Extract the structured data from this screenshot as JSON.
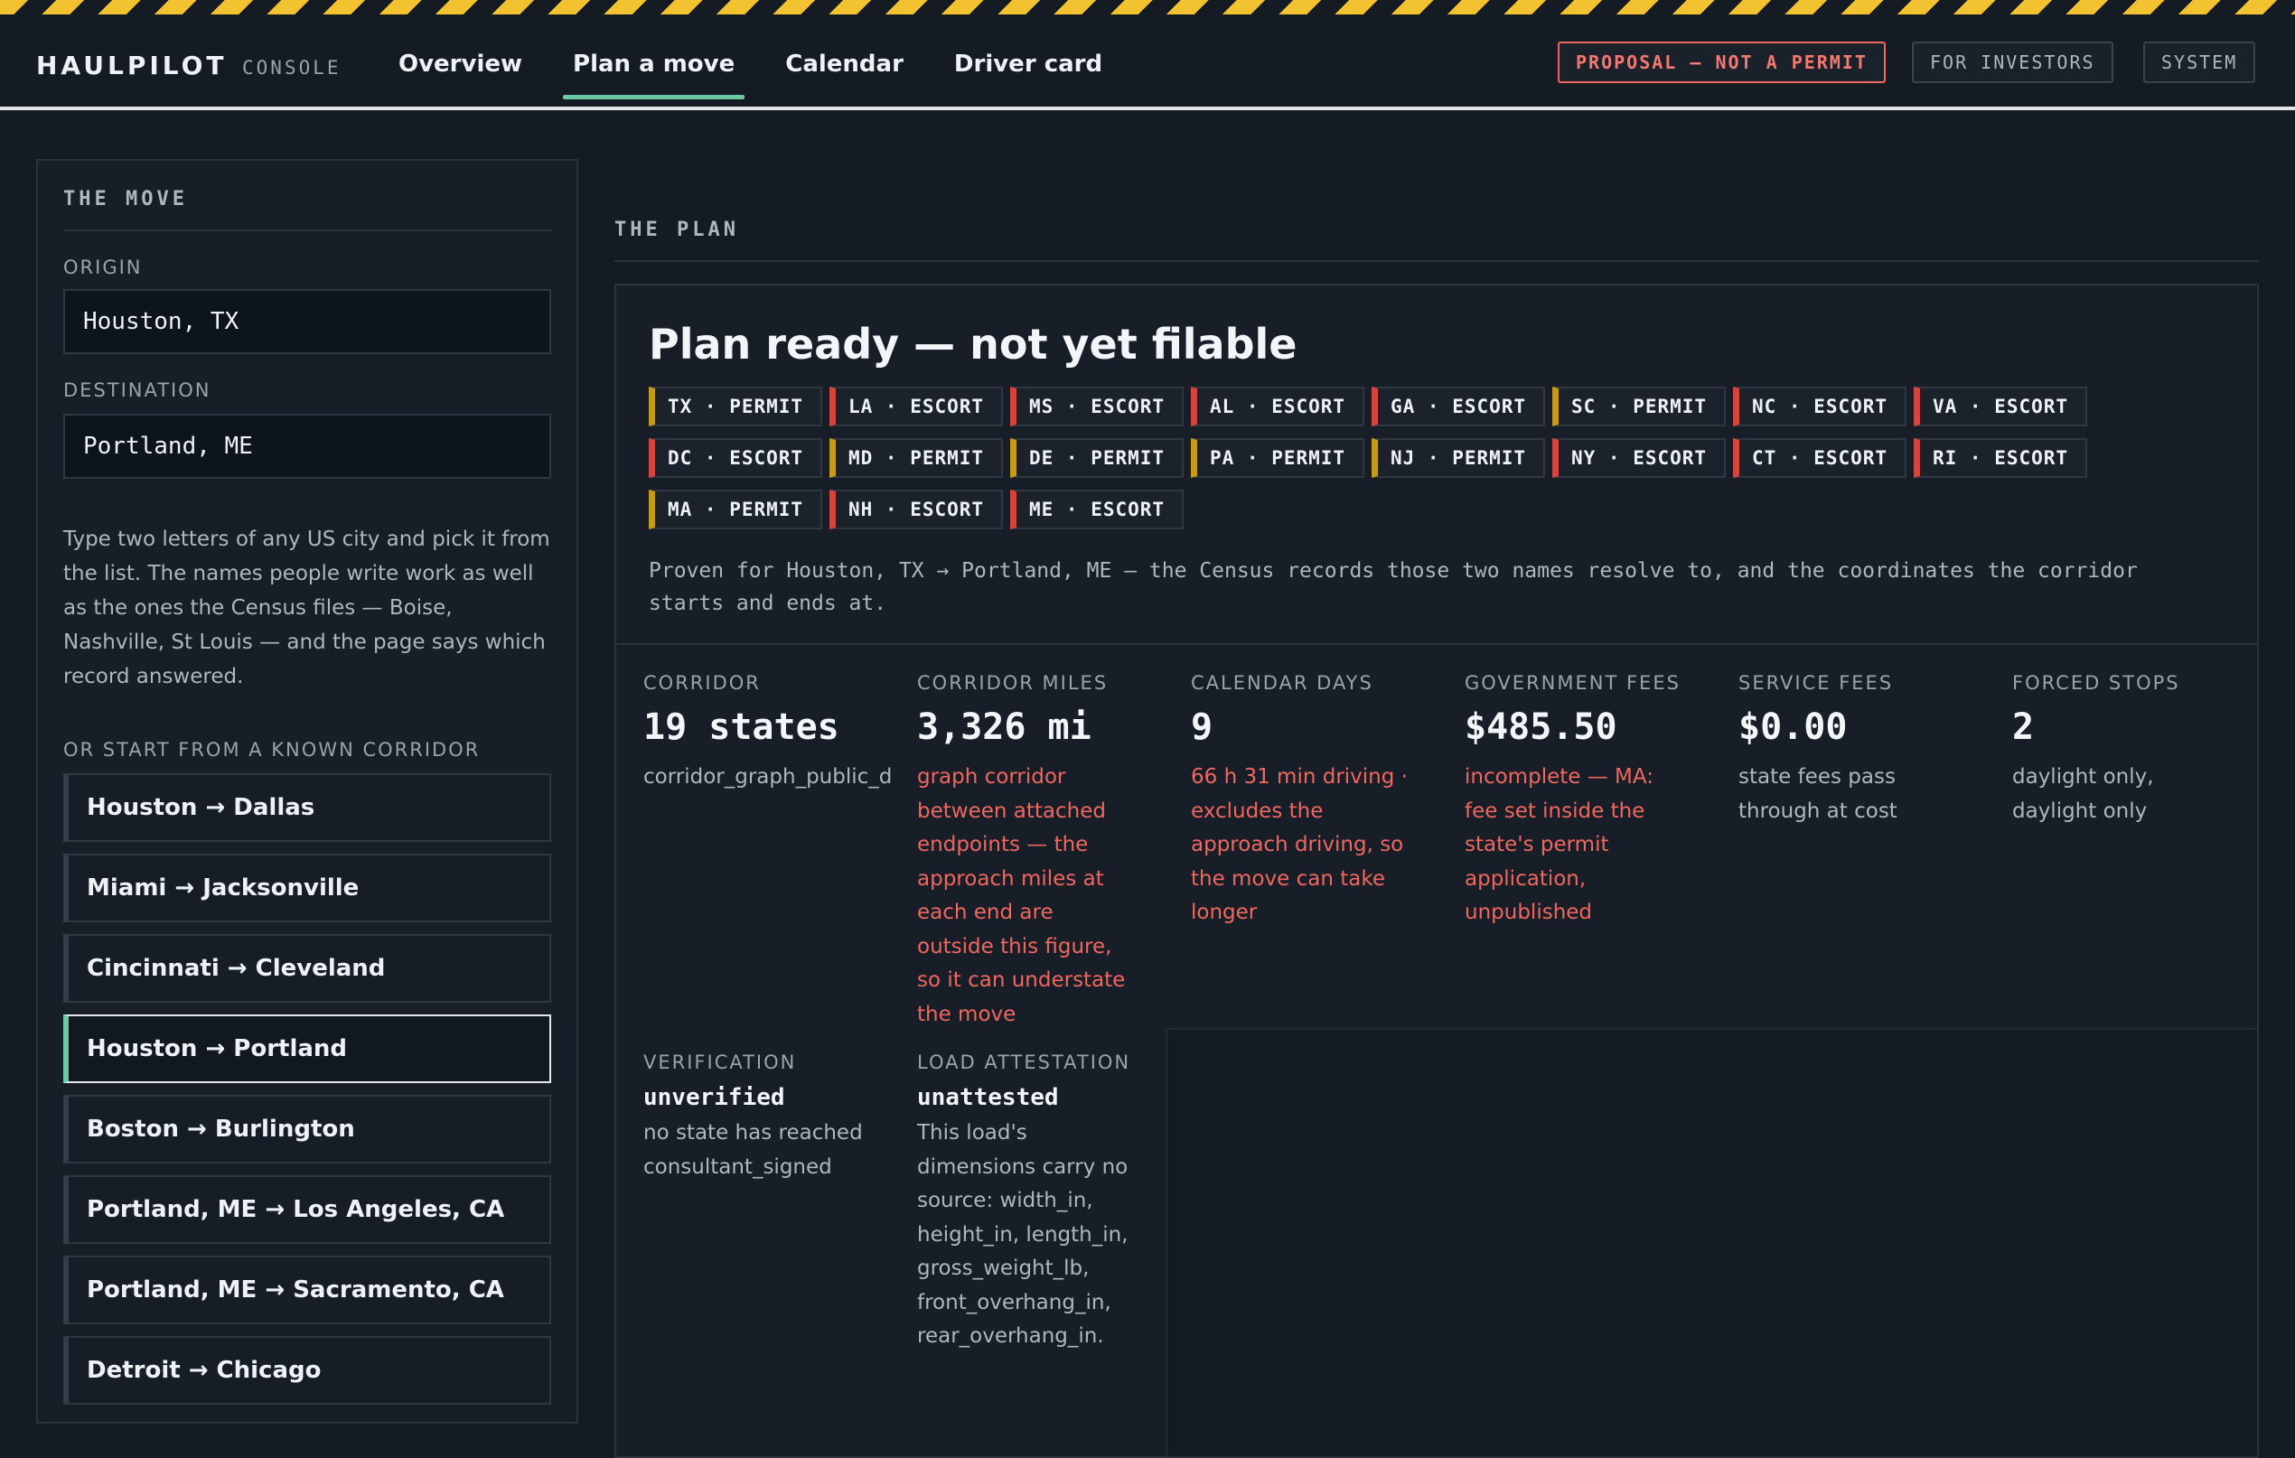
{
  "app": {
    "brand": "HAULPILOT",
    "brand_sub": "CONSOLE"
  },
  "nav": {
    "tabs": [
      {
        "label": "Overview"
      },
      {
        "label": "Plan a move",
        "active": true
      },
      {
        "label": "Calendar"
      },
      {
        "label": "Driver card"
      }
    ]
  },
  "top_actions": {
    "proposal": "PROPOSAL — NOT A PERMIT",
    "investors": "FOR INVESTORS",
    "system": "SYSTEM"
  },
  "move": {
    "title": "THE MOVE",
    "origin_label": "ORIGIN",
    "origin_value": "Houston, TX",
    "destination_label": "DESTINATION",
    "destination_value": "Portland, ME",
    "help": "Type two letters of any US city and pick it from the list. The names people write work as well as the ones the Census files — Boise, Nashville, St Louis — and the page says which record answered.",
    "corridor_label": "OR START FROM A KNOWN CORRIDOR",
    "corridors": [
      "Houston → Dallas",
      "Miami → Jacksonville",
      "Cincinnati → Cleveland",
      "Houston → Portland",
      "Boston → Burlington",
      "Portland, ME → Los Angeles, CA",
      "Portland, ME → Sacramento, CA",
      "Detroit → Chicago"
    ],
    "active_corridor": "Houston → Portland"
  },
  "plan": {
    "title": "THE PLAN",
    "status": "Plan ready — not yet filable",
    "states": [
      {
        "label": "TX · PERMIT",
        "kind": "permit"
      },
      {
        "label": "LA · ESCORT",
        "kind": "escort"
      },
      {
        "label": "MS · ESCORT",
        "kind": "escort"
      },
      {
        "label": "AL · ESCORT",
        "kind": "escort"
      },
      {
        "label": "GA · ESCORT",
        "kind": "escort"
      },
      {
        "label": "SC · PERMIT",
        "kind": "permit"
      },
      {
        "label": "NC · ESCORT",
        "kind": "escort"
      },
      {
        "label": "VA · ESCORT",
        "kind": "escort"
      },
      {
        "label": "DC · ESCORT",
        "kind": "escort"
      },
      {
        "label": "MD · PERMIT",
        "kind": "permit"
      },
      {
        "label": "DE · PERMIT",
        "kind": "permit"
      },
      {
        "label": "PA · PERMIT",
        "kind": "permit"
      },
      {
        "label": "NJ · PERMIT",
        "kind": "permit"
      },
      {
        "label": "NY · ESCORT",
        "kind": "escort"
      },
      {
        "label": "CT · ESCORT",
        "kind": "escort"
      },
      {
        "label": "RI · ESCORT",
        "kind": "escort"
      },
      {
        "label": "MA · PERMIT",
        "kind": "permit"
      },
      {
        "label": "NH · ESCORT",
        "kind": "escort"
      },
      {
        "label": "ME · ESCORT",
        "kind": "escort"
      }
    ],
    "proven": "Proven for Houston, TX → Portland, ME — the Census records those two names resolve to, and the coordinates the corridor starts and ends at.",
    "stats": {
      "corridor": {
        "label": "CORRIDOR",
        "value": "19 states",
        "note": "corridor_graph_public_data"
      },
      "miles": {
        "label": "CORRIDOR MILES",
        "value": "3,326 mi",
        "note": "graph corridor between attached endpoints — the approach miles at each end are outside this figure, so it can understate the move"
      },
      "days": {
        "label": "CALENDAR DAYS",
        "value": "9",
        "note": "66 h 31 min driving · excludes the approach driving, so the move can take longer"
      },
      "gov_fees": {
        "label": "GOVERNMENT FEES",
        "value": "$485.50",
        "note": "incomplete — MA: fee set inside the state's permit application, unpublished"
      },
      "service_fees": {
        "label": "SERVICE FEES",
        "value": "$0.00",
        "note": "state fees pass through at cost"
      },
      "stops": {
        "label": "FORCED STOPS",
        "value": "2",
        "note": "daylight only, daylight only"
      },
      "verification": {
        "label": "VERIFICATION",
        "value": "unverified",
        "note": "no state has reached consultant_signed"
      },
      "attestation": {
        "label": "LOAD ATTESTATION",
        "value": "unattested",
        "note": "This load's dimensions carry no source: width_in, height_in, length_in, gross_weight_lb, front_overhang_in, rear_overhang_in."
      }
    }
  }
}
